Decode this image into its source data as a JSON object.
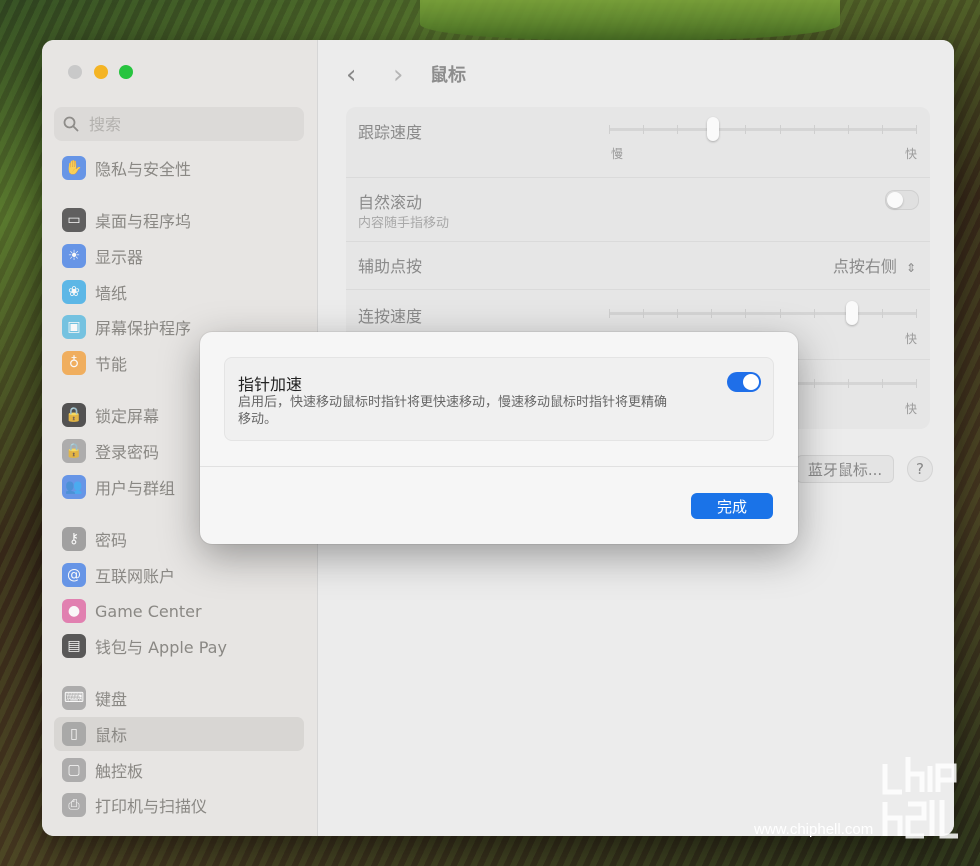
{
  "window": {
    "title": "鼠标"
  },
  "search": {
    "placeholder": "搜索"
  },
  "sidebar": {
    "items": [
      {
        "label": "隐私与安全性",
        "icon": "hand-icon",
        "color": "#3d7be8",
        "glyph": "✋"
      },
      {
        "label": "桌面与程序坞",
        "icon": "dock-icon",
        "color": "#333333",
        "glyph": "▭"
      },
      {
        "label": "显示器",
        "icon": "display-brightness-icon",
        "color": "#3d7be8",
        "glyph": "☀"
      },
      {
        "label": "墙纸",
        "icon": "wallpaper-icon",
        "color": "#2fa8e8",
        "glyph": "❀"
      },
      {
        "label": "屏幕保护程序",
        "icon": "screensaver-icon",
        "color": "#4fb7e0",
        "glyph": "▣"
      },
      {
        "label": "节能",
        "icon": "lightbulb-icon",
        "color": "#f39c32",
        "glyph": "♁"
      },
      {
        "label": "锁定屏幕",
        "icon": "lock-icon",
        "color": "#222222",
        "glyph": "🔒"
      },
      {
        "label": "登录密码",
        "icon": "login-lock-icon",
        "color": "#9a9a9a",
        "glyph": "🔒"
      },
      {
        "label": "用户与群组",
        "icon": "users-icon",
        "color": "#3d7be8",
        "glyph": "👥"
      },
      {
        "label": "密码",
        "icon": "key-icon",
        "color": "#8a8a8a",
        "glyph": "⚷"
      },
      {
        "label": "互联网账户",
        "icon": "at-icon",
        "color": "#3d7be8",
        "glyph": "@"
      },
      {
        "label": "Game Center",
        "icon": "game-center-icon",
        "color": "#e05fa0",
        "glyph": "●"
      },
      {
        "label": "钱包与 Apple Pay",
        "icon": "wallet-icon",
        "color": "#2a2a2a",
        "glyph": "▤"
      },
      {
        "label": "键盘",
        "icon": "keyboard-icon",
        "color": "#9a9a9a",
        "glyph": "⌨"
      },
      {
        "label": "鼠标",
        "icon": "mouse-icon",
        "color": "#9a9a9a",
        "glyph": "▯"
      },
      {
        "label": "触控板",
        "icon": "trackpad-icon",
        "color": "#9a9a9a",
        "glyph": "▢"
      },
      {
        "label": "打印机与扫描仪",
        "icon": "printer-icon",
        "color": "#9a9a9a",
        "glyph": "⎙"
      }
    ]
  },
  "settings": {
    "tracking_speed": {
      "label": "跟踪速度",
      "min_label": "慢",
      "max_label": "快",
      "value": 0.33
    },
    "natural_scroll": {
      "label": "自然滚动",
      "sub": "内容随手指移动",
      "enabled": false
    },
    "secondary_click": {
      "label": "辅助点按",
      "value": "点按右侧"
    },
    "double_click_speed": {
      "label": "连按速度",
      "max_label": "快",
      "value": 0.8
    },
    "scroll_speed": {
      "max_label": "快"
    },
    "bluetooth_button": "蓝牙鼠标...",
    "help_button": "?"
  },
  "modal": {
    "title": "指针加速",
    "description": "启用后，快速移动鼠标时指针将更快速移动，慢速移动鼠标时指针将更精确移动。",
    "enabled": true,
    "done_label": "完成"
  },
  "watermark": {
    "url": "www.chiphell.com",
    "logo": "chiphell-logo"
  },
  "colors": {
    "accent": "#1a73e8",
    "toggle_on": "#1f6fe9"
  }
}
